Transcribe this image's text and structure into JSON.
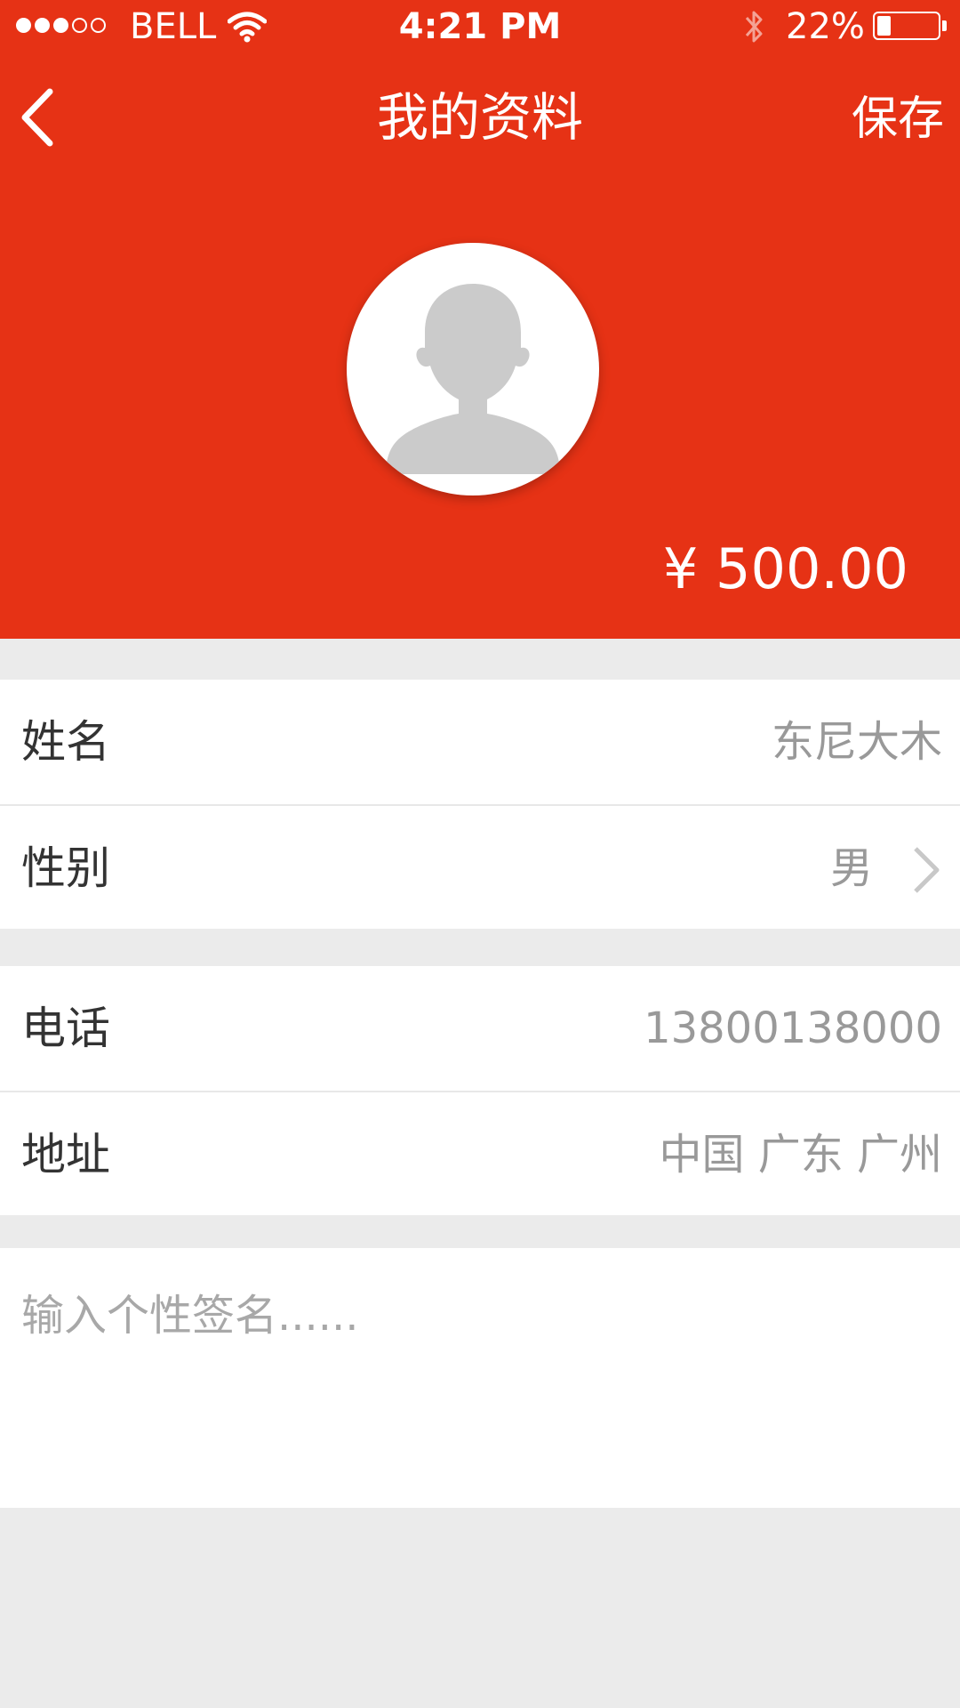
{
  "status_bar": {
    "carrier": "BELL",
    "time": "4:21 PM",
    "battery": "22%",
    "battery_level": 0.22
  },
  "nav": {
    "title": "我的资料",
    "save_label": "保存"
  },
  "profile": {
    "balance": "¥ 500.00"
  },
  "form": {
    "name": {
      "label": "姓名",
      "value": "东尼大木"
    },
    "gender": {
      "label": "性别",
      "value": "男"
    },
    "phone": {
      "label": "电话",
      "value": "13800138000"
    },
    "address": {
      "label": "地址",
      "value": "中国 广东 广州"
    },
    "signature_placeholder": "输入个性签名......"
  },
  "colors": {
    "brand": "#e63215",
    "background": "#ebebeb",
    "value_text": "#999999"
  }
}
